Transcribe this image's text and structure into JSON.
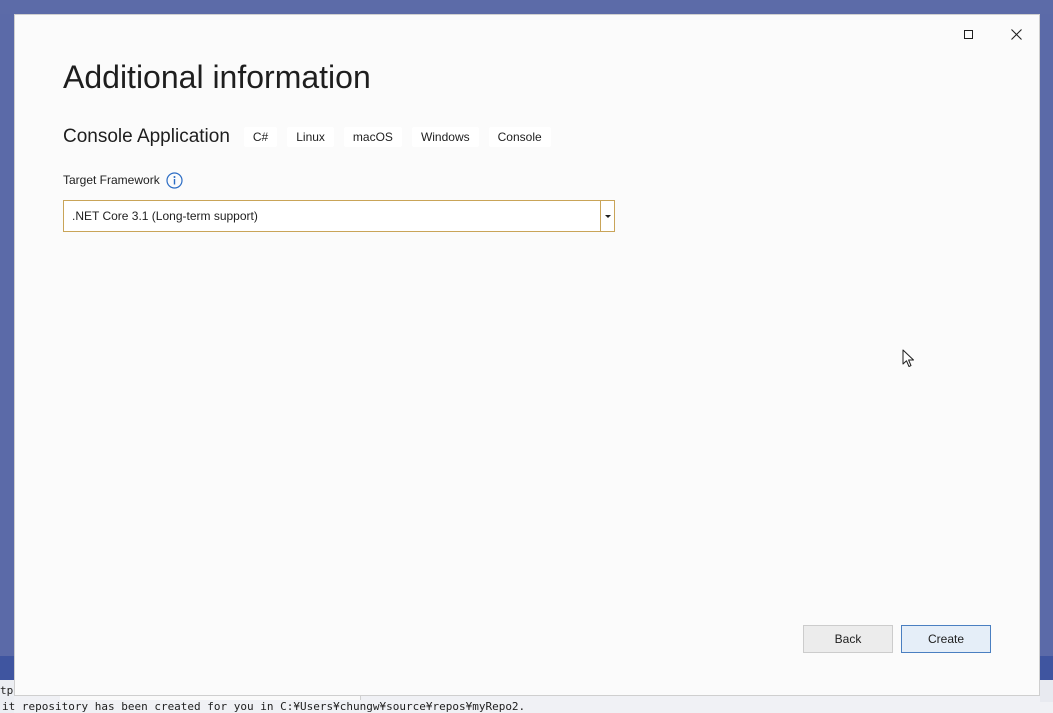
{
  "background": {
    "left_fragment": "tpu",
    "output_line": "it repository has been created for you in C:¥Users¥chungw¥source¥repos¥myRepo2."
  },
  "dialog": {
    "title": "Additional information",
    "project_name": "Console Application",
    "tags": [
      "C#",
      "Linux",
      "macOS",
      "Windows",
      "Console"
    ],
    "field_label": "Target Framework",
    "framework_value": ".NET Core 3.1 (Long-term support)",
    "back_label": "Back",
    "create_label": "Create"
  },
  "colors": {
    "select_border": "#c9a458",
    "primary_button_border": "#4a7fc1",
    "info_icon": "#2b6cc4"
  }
}
